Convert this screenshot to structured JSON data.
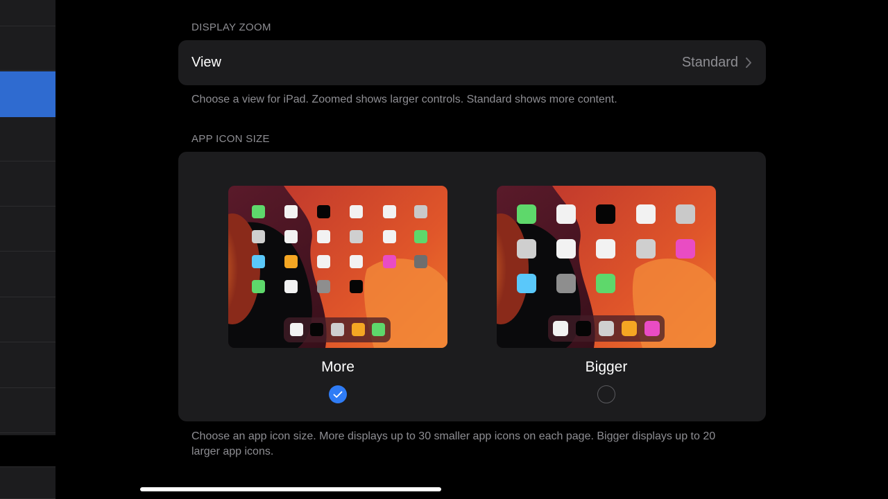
{
  "display_zoom": {
    "header": "DISPLAY ZOOM",
    "view_label": "View",
    "view_value": "Standard",
    "footnote": "Choose a view for iPad. Zoomed shows larger controls. Standard shows more content."
  },
  "app_icon_size": {
    "header": "APP ICON SIZE",
    "options": [
      {
        "label": "More",
        "selected": true
      },
      {
        "label": "Bigger",
        "selected": false
      }
    ],
    "footnote_line1": "Choose an app icon size. More displays up to 30 smaller app icons on each page. Bigger displays up to 20",
    "footnote_line2": "larger app icons."
  },
  "colors": {
    "accent": "#2f7cf6",
    "sidebar_selected": "#2f6bd0",
    "group_bg": "#1c1c1e",
    "secondary_text": "#8e8e93"
  },
  "icons": {
    "chevron": "chevron-right-icon",
    "check": "checkmark-icon"
  }
}
